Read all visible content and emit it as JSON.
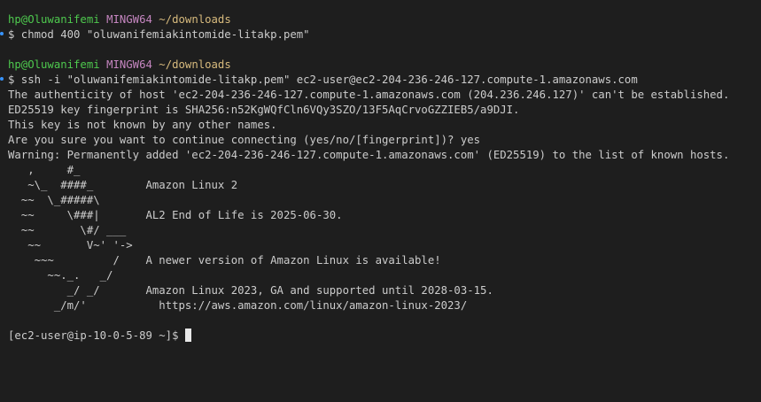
{
  "session1": {
    "user": "hp@Oluwanifemi",
    "system": "MINGW64",
    "path": "~/downloads",
    "command": "$ chmod 400 \"oluwanifemiakintomide-litakp.pem\""
  },
  "session2": {
    "user": "hp@Oluwanifemi",
    "system": "MINGW64",
    "path": "~/downloads",
    "command": "$ ssh -i \"oluwanifemiakintomide-litakp.pem\" ec2-user@ec2-204-236-246-127.compute-1.amazonaws.com"
  },
  "output": [
    "The authenticity of host 'ec2-204-236-246-127.compute-1.amazonaws.com (204.236.246.127)' can't be established.",
    "ED25519 key fingerprint is SHA256:n52KgWQfCln6VQy3SZO/13F5AqCrvoGZZIEB5/a9DJI.",
    "This key is not known by any other names.",
    "Are you sure you want to continue connecting (yes/no/[fingerprint])? yes",
    "Warning: Permanently added 'ec2-204-236-246-127.compute-1.amazonaws.com' (ED25519) to the list of known hosts."
  ],
  "banner": [
    "   ,     #_",
    "   ~\\_  ####_        Amazon Linux 2",
    "  ~~  \\_#####\\",
    "  ~~     \\###|       AL2 End of Life is 2025-06-30.",
    "  ~~       \\#/ ___",
    "   ~~       V~' '->",
    "    ~~~         /    A newer version of Amazon Linux is available!",
    "      ~~._.   _/",
    "         _/ _/       Amazon Linux 2023, GA and supported until 2028-03-15.",
    "       _/m/'           https://aws.amazon.com/linux/amazon-linux-2023/"
  ],
  "remote_prompt": "[ec2-user@ip-10-0-5-89 ~]$ ",
  "colors": {
    "background": "#1e1e1e",
    "user": "#4ec94e",
    "system": "#c586c0",
    "path": "#d7ba7d",
    "text": "#cccccc"
  }
}
